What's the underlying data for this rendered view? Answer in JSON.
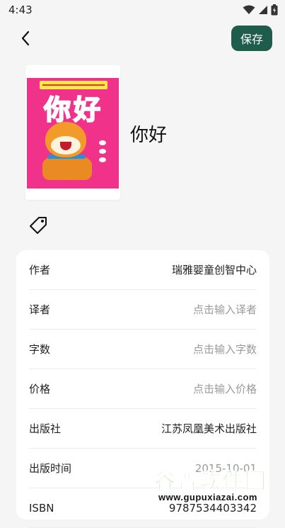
{
  "status_bar": {
    "time": "4:43"
  },
  "toolbar": {
    "save_label": "保存"
  },
  "book": {
    "title": "你好",
    "cover_title": "你好"
  },
  "fields": [
    {
      "label": "作者",
      "value": "瑞雅婴童创智中心",
      "placeholder": ""
    },
    {
      "label": "译者",
      "value": "",
      "placeholder": "点击输入译者"
    },
    {
      "label": "字数",
      "value": "",
      "placeholder": "点击输入字数"
    },
    {
      "label": "价格",
      "value": "",
      "placeholder": "点击输入价格"
    },
    {
      "label": "出版社",
      "value": "江苏凤凰美术出版社",
      "placeholder": ""
    },
    {
      "label": "出版时间",
      "value": "2015-10-01",
      "placeholder": ""
    },
    {
      "label": "ISBN",
      "value": "9787534403342",
      "placeholder": ""
    }
  ],
  "watermark": {
    "brand": "谷普软件园",
    "url": "www.gupuxiazai.com"
  },
  "colors": {
    "accent": "#1f5c4b",
    "background": "#f5f5f5",
    "placeholder": "#9a9a9a"
  },
  "icons": [
    "wifi-icon",
    "signal-icon",
    "battery-icon",
    "back-arrow-icon",
    "tag-icon"
  ]
}
